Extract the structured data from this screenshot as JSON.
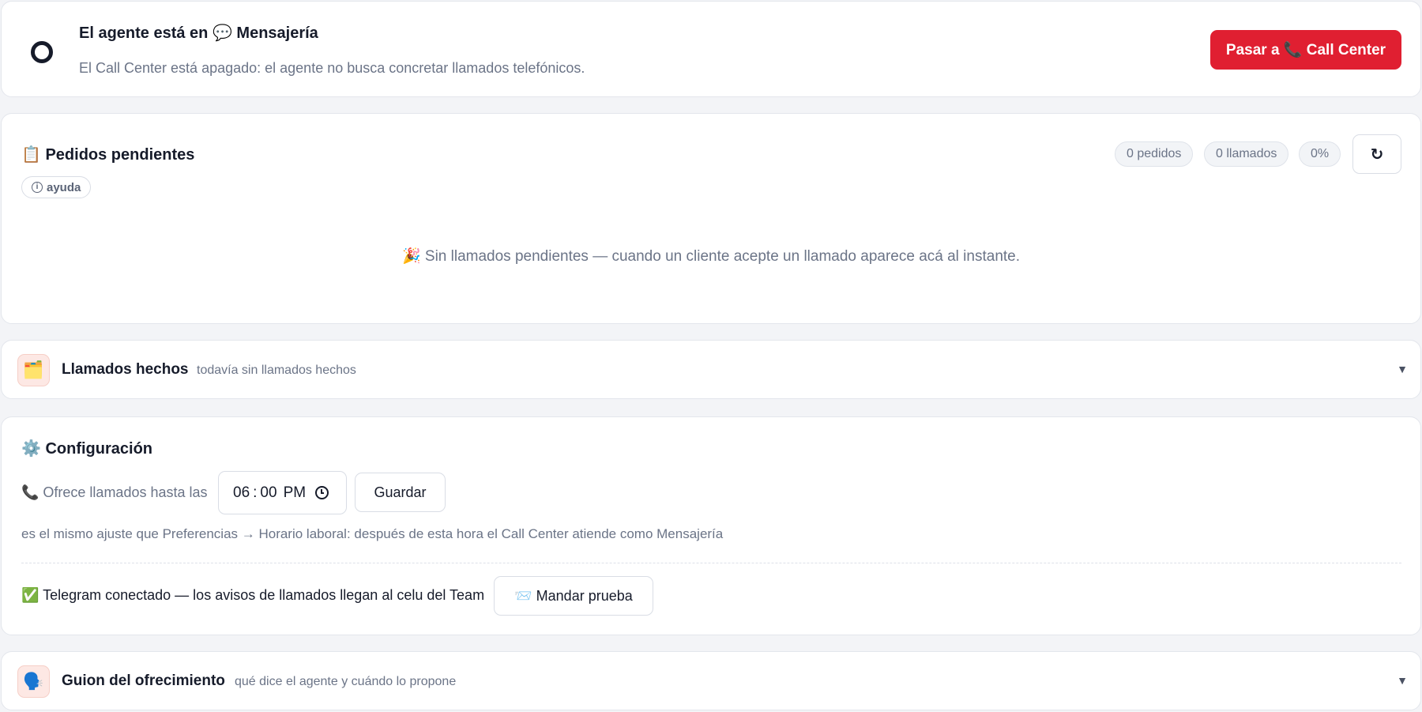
{
  "status": {
    "title": "El agente está en 💬 Mensajería",
    "subtitle": "El Call Center está apagado: el agente no busca concretar llamados telefónicos.",
    "switch_button": "Pasar a 📞 Call Center"
  },
  "pending": {
    "title": "📋 Pedidos pendientes",
    "help_label": "ayuda",
    "stats": {
      "orders": "0 pedidos",
      "calls": "0 llamados",
      "percent": "0%"
    },
    "refresh_symbol": "↻",
    "empty_message": "🎉 Sin llamados pendientes — cuando un cliente acepte un llamado aparece acá al instante."
  },
  "calls_done": {
    "emoji": "🗂️",
    "title": "Llamados hechos",
    "hint": "todavía sin llamados hechos"
  },
  "config": {
    "title": "⚙️ Configuración",
    "offer_label": "📞 Ofrece llamados hasta las",
    "time": {
      "hours": "06",
      "minutes": "00",
      "period": "PM"
    },
    "save_button": "Guardar",
    "note": "es el mismo ajuste que Preferencias → Horario laboral: después de esta hora el Call Center atiende como Mensajería",
    "telegram_status": "✅ Telegram conectado — los avisos de llamados llegan al celu del Team",
    "test_button": "📨 Mandar prueba"
  },
  "script": {
    "emoji": "🗣️",
    "title": "Guion del ofrecimiento",
    "hint": "qué dice el agente y cuándo lo propone"
  },
  "icons": {
    "status_indicator": "ring-icon",
    "help": "info-icon",
    "refresh": "refresh-icon",
    "clock": "clock-icon",
    "chevron": "chevron-down-icon"
  },
  "colors": {
    "accent_red": "#e01f31",
    "background": "#f3f4f7",
    "muted_text": "#6b7487",
    "dark_text": "#161b2a"
  }
}
